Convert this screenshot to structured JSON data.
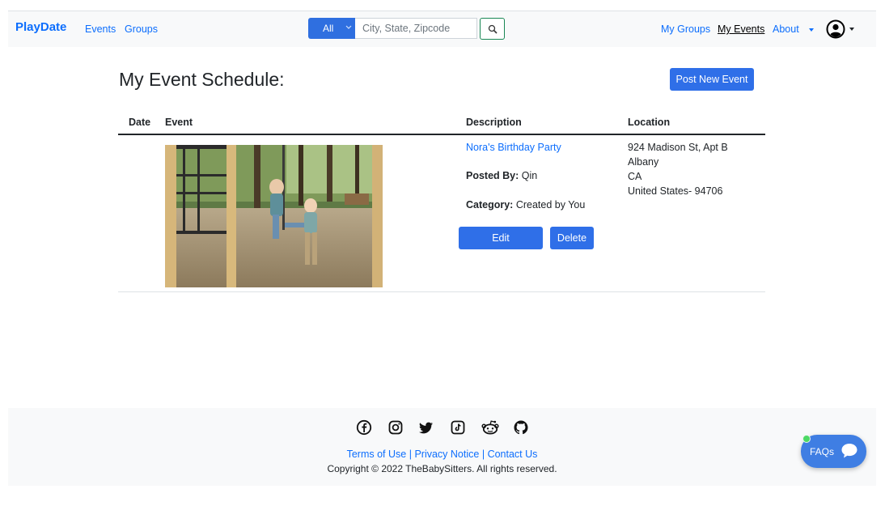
{
  "nav": {
    "brand": "PlayDate",
    "events": "Events",
    "groups": "Groups",
    "filter_value": "All",
    "search_placeholder": "City, State, Zipcode",
    "my_groups": "My Groups",
    "my_events": "My Events",
    "about": "About"
  },
  "page": {
    "title": "My Event Schedule:",
    "post_button": "Post New Event"
  },
  "table": {
    "headers": [
      "Date",
      "Event",
      "Description",
      "Location"
    ],
    "rows": [
      {
        "title": "Nora's Birthday Party",
        "posted_by_label": "Posted By:",
        "posted_by": "Qin",
        "category_label": "Category:",
        "category": "Created by You",
        "edit": "Edit",
        "delete": "Delete",
        "location": [
          "924 Madison St, Apt B",
          "Albany",
          "CA",
          "United States- 94706"
        ]
      }
    ]
  },
  "footer": {
    "social_icons": [
      "facebook-icon",
      "instagram-icon",
      "twitter-icon",
      "tiktok-icon",
      "reddit-icon",
      "github-icon"
    ],
    "links": [
      "Terms of Use",
      "Privacy Notice",
      "Contact Us"
    ],
    "separator": "|",
    "copyright": "Copyright © 2022 TheBabySitters. All rights reserved."
  },
  "faq": {
    "label": "FAQs"
  },
  "colors": {
    "primary": "#2f6fe8",
    "link": "#0d6efd",
    "search_border": "#198754",
    "status_dot": "#4cd964"
  }
}
